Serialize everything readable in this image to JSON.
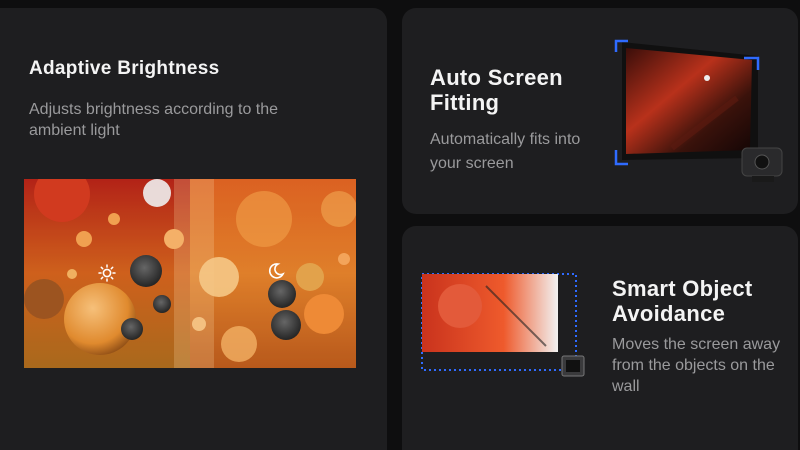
{
  "cards": {
    "adaptive": {
      "title": "Adaptive Brightness",
      "description": "Adjusts brightness according to the ambient light",
      "icons": {
        "day": "sun-icon",
        "night": "moon-icon"
      }
    },
    "fitting": {
      "title": "Auto Screen Fitting",
      "description": "Automatically fits into your screen"
    },
    "avoid": {
      "title": "Smart Object Avoidance",
      "description": "Moves the screen away from the objects on the wall"
    }
  },
  "colors": {
    "background": "#0e0e0f",
    "card": "#1e1e20",
    "title": "#f4f4f4",
    "description": "#9a9a9c",
    "accent_blue": "#2f6bff"
  }
}
